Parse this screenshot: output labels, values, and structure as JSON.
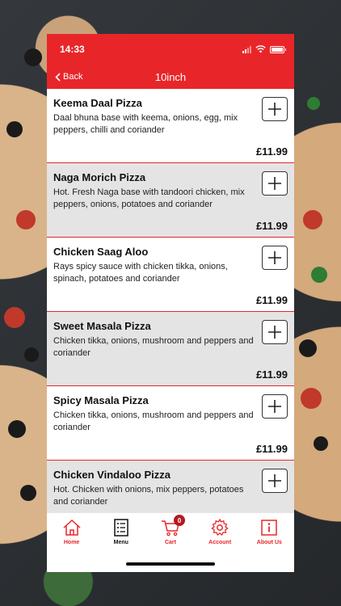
{
  "status": {
    "time": "14:33"
  },
  "nav": {
    "back_label": "Back",
    "title": "10inch"
  },
  "items": [
    {
      "name": "Keema Daal Pizza",
      "description": "Daal bhuna base with keema, onions, egg, mix peppers, chilli and coriander",
      "price": "£11.99"
    },
    {
      "name": "Naga Morich Pizza",
      "description": "Hot. Fresh Naga base with tandoori chicken, mix peppers, onions, potatoes and coriander",
      "price": "£11.99"
    },
    {
      "name": "Chicken Saag Aloo",
      "description": "Rays spicy sauce with chicken tikka, onions, spinach, potatoes and coriander",
      "price": "£11.99"
    },
    {
      "name": "Sweet Masala Pizza",
      "description": "Chicken tikka, onions, mushroom and peppers and coriander",
      "price": "£11.99"
    },
    {
      "name": "Spicy Masala Pizza",
      "description": "Chicken tikka, onions, mushroom and peppers and coriander",
      "price": "£11.99"
    },
    {
      "name": "Chicken Vindaloo Pizza",
      "description": "Hot. Chicken with onions, mix peppers, potatoes and coriander",
      "price": ""
    }
  ],
  "tabs": [
    {
      "label": "Home",
      "icon": "home-icon"
    },
    {
      "label": "Menu",
      "icon": "menu-icon"
    },
    {
      "label": "Cart",
      "icon": "cart-icon",
      "badge": "0"
    },
    {
      "label": "Account",
      "icon": "gear-icon"
    },
    {
      "label": "About Us",
      "icon": "info-icon"
    }
  ],
  "colors": {
    "accent": "#e8262a",
    "row_alt": "#e4e4e4"
  }
}
